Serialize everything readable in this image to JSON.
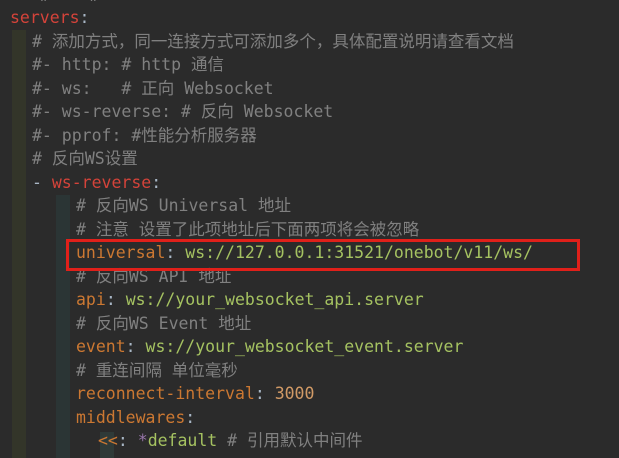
{
  "top_fragment": "  #    # ",
  "lines": [
    {
      "indent": 10,
      "parts": [
        {
          "t": "servers",
          "c": "key2"
        },
        {
          "t": ":",
          "c": "punct"
        }
      ]
    },
    {
      "indent": 32,
      "parts": [
        {
          "t": "# 添加方式，同一连接方式可添加多个，具体配置说明请查看文档",
          "c": "cmt"
        }
      ]
    },
    {
      "indent": 32,
      "parts": [
        {
          "t": "#- http: # http 通信",
          "c": "cmt"
        }
      ]
    },
    {
      "indent": 32,
      "parts": [
        {
          "t": "#- ws:   # 正向 Websocket",
          "c": "cmt"
        }
      ]
    },
    {
      "indent": 32,
      "parts": [
        {
          "t": "#- ws-reverse: # 反向 Websocket",
          "c": "cmt"
        }
      ]
    },
    {
      "indent": 32,
      "parts": [
        {
          "t": "#- pprof: #性能分析服务器",
          "c": "cmt"
        }
      ]
    },
    {
      "indent": 32,
      "parts": [
        {
          "t": "# 反向WS设置",
          "c": "cmt"
        }
      ]
    },
    {
      "indent": 32,
      "parts": [
        {
          "t": "- ",
          "c": "punct"
        },
        {
          "t": "ws-reverse",
          "c": "key2"
        },
        {
          "t": ":",
          "c": "punct"
        }
      ]
    },
    {
      "indent": 76,
      "parts": [
        {
          "t": "# 反向WS Universal 地址",
          "c": "cmt"
        }
      ]
    },
    {
      "indent": 76,
      "parts": [
        {
          "t": "# 注意 设置了此项地址后下面两项将会被忽略",
          "c": "cmt"
        }
      ]
    },
    {
      "indent": 76,
      "parts": [
        {
          "t": "universal",
          "c": "key"
        },
        {
          "t": ": ",
          "c": "punct"
        },
        {
          "t": "ws://127.0.0.1:31521/onebot/v11/ws/",
          "c": "val"
        }
      ]
    },
    {
      "indent": 76,
      "parts": [
        {
          "t": "# 反向WS API 地址",
          "c": "cmt"
        }
      ]
    },
    {
      "indent": 76,
      "parts": [
        {
          "t": "api",
          "c": "key"
        },
        {
          "t": ": ",
          "c": "punct"
        },
        {
          "t": "ws://your_websocket_api.server",
          "c": "val"
        }
      ]
    },
    {
      "indent": 76,
      "parts": [
        {
          "t": "# 反向WS Event 地址",
          "c": "cmt"
        }
      ]
    },
    {
      "indent": 76,
      "parts": [
        {
          "t": "event",
          "c": "key"
        },
        {
          "t": ": ",
          "c": "punct"
        },
        {
          "t": "ws://your_websocket_event.server",
          "c": "val"
        }
      ]
    },
    {
      "indent": 76,
      "parts": [
        {
          "t": "# 重连间隔 单位毫秒",
          "c": "cmt"
        }
      ]
    },
    {
      "indent": 76,
      "parts": [
        {
          "t": "reconnect-interval",
          "c": "key"
        },
        {
          "t": ": ",
          "c": "punct"
        },
        {
          "t": "3000",
          "c": "num"
        }
      ]
    },
    {
      "indent": 76,
      "parts": [
        {
          "t": "middlewares",
          "c": "key"
        },
        {
          "t": ":",
          "c": "punct"
        }
      ]
    },
    {
      "indent": 98,
      "parts": [
        {
          "t": "<<",
          "c": "anchor"
        },
        {
          "t": ": ",
          "c": "punct"
        },
        {
          "t": "*",
          "c": "star"
        },
        {
          "t": "default",
          "c": "val"
        },
        {
          "t": " # 引用默认中间件",
          "c": "cmt"
        }
      ]
    }
  ]
}
